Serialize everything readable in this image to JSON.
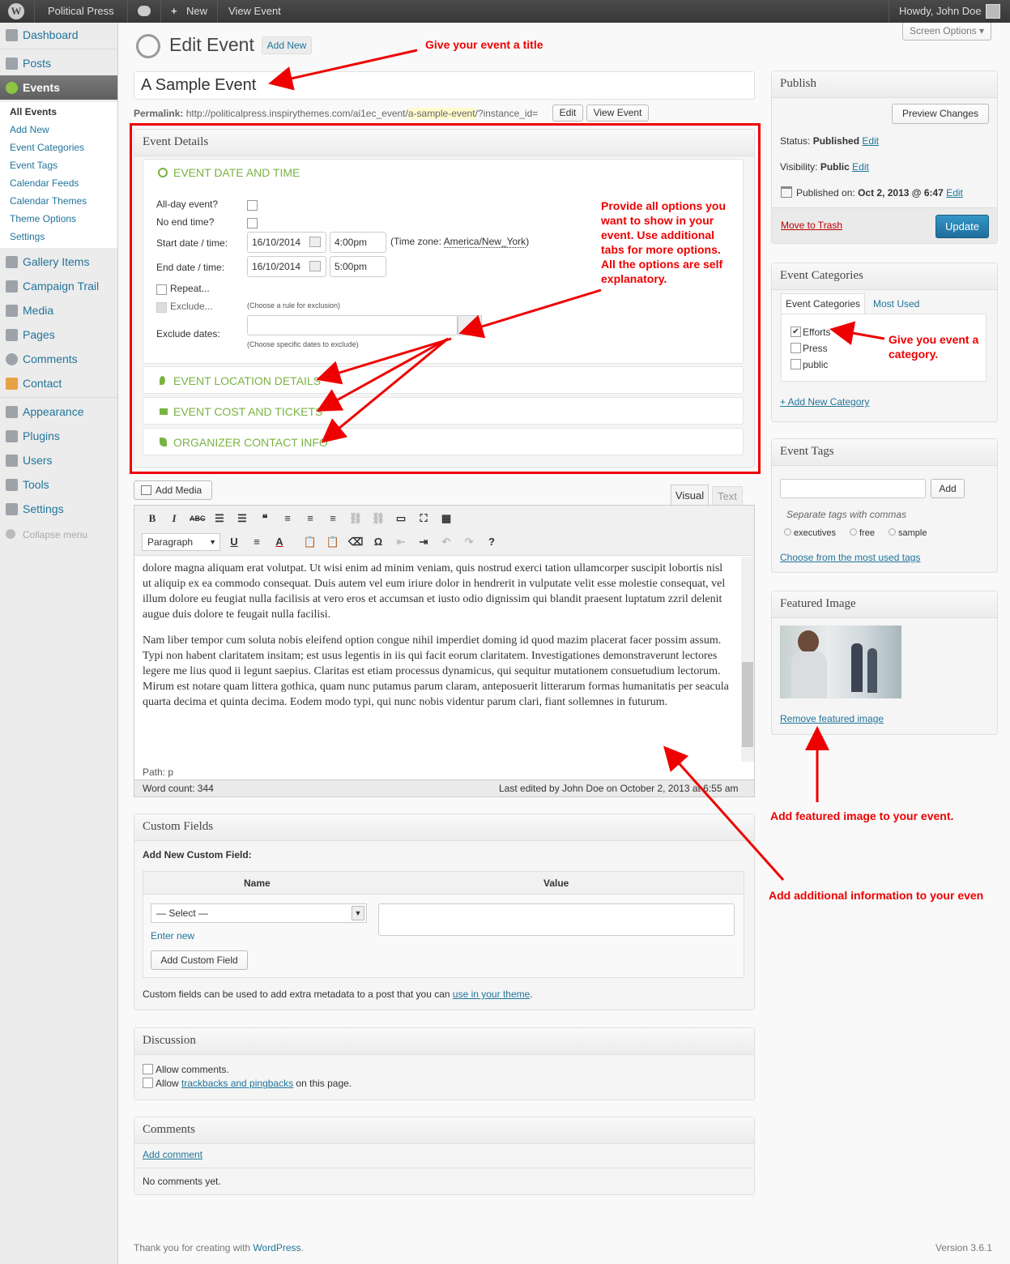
{
  "adminbar": {
    "site": "Political Press",
    "new": "New",
    "view": "View Event",
    "howdy": "Howdy, John Doe"
  },
  "menu": {
    "dashboard": "Dashboard",
    "posts": "Posts",
    "events": "Events",
    "events_sub": [
      "All Events",
      "Add New",
      "Event Categories",
      "Event Tags",
      "Calendar Feeds",
      "Calendar Themes",
      "Theme Options",
      "Settings"
    ],
    "gallery": "Gallery Items",
    "campaign": "Campaign Trail",
    "media": "Media",
    "pages": "Pages",
    "comments": "Comments",
    "contact": "Contact",
    "appearance": "Appearance",
    "plugins": "Plugins",
    "users": "Users",
    "tools": "Tools",
    "settings": "Settings",
    "collapse": "Collapse menu"
  },
  "screen_options": "Screen Options",
  "page": {
    "title": "Edit Event",
    "add_new": "Add New",
    "post_title": "A Sample Event",
    "permalink_label": "Permalink:",
    "permalink_pre": "http://politicalpress.inspirythemes.com/ai1ec_event/",
    "permalink_slug": "a-sample-event",
    "permalink_post": "/?instance_id=",
    "edit_btn": "Edit",
    "view_btn": "View Event"
  },
  "event_details": {
    "title": "Event Details",
    "section_date": "EVENT DATE AND TIME",
    "allday": "All-day event?",
    "noend": "No end time?",
    "start_label": "Start date / time:",
    "start_date": "16/10/2014",
    "start_time": "4:00pm",
    "tz_pre": "(Time zone:",
    "tz": "America/New_York",
    "tz_post": ")",
    "end_label": "End date / time:",
    "end_date": "16/10/2014",
    "end_time": "5:00pm",
    "repeat": "Repeat...",
    "exclude": "Exclude...",
    "exclude_hint": "(Choose a rule for exclusion)",
    "exclude_dates": "Exclude dates:",
    "exclude_dates_hint": "(Choose specific dates to exclude)",
    "location": "EVENT LOCATION DETAILS",
    "cost": "EVENT COST AND TICKETS",
    "organizer": "ORGANIZER CONTACT INFO"
  },
  "editor": {
    "add_media": "Add Media",
    "visual": "Visual",
    "text": "Text",
    "format": "Paragraph",
    "p1": "dolore magna aliquam erat volutpat. Ut wisi enim ad minim veniam, quis nostrud exerci tation ullamcorper suscipit lobortis nisl ut aliquip ex ea commodo consequat. Duis autem vel eum iriure dolor in hendrerit in vulputate velit esse molestie consequat, vel illum dolore eu feugiat nulla facilisis at vero eros et accumsan et iusto odio dignissim qui blandit praesent luptatum zzril delenit augue duis dolore te feugait nulla facilisi.",
    "p2": "Nam liber tempor cum soluta nobis eleifend option congue nihil imperdiet doming id quod mazim placerat facer possim assum. Typi non habent claritatem insitam; est usus legentis in iis qui facit eorum claritatem. Investigationes demonstraverunt lectores legere me lius quod ii legunt saepius. Claritas est etiam processus dynamicus, qui sequitur mutationem consuetudium lectorum. Mirum est notare quam littera gothica, quam nunc putamus parum claram, anteposuerit litterarum formas humanitatis per seacula quarta decima et quinta decima. Eodem modo typi, qui nunc nobis videntur parum clari, fiant sollemnes in futurum.",
    "path": "Path: p",
    "wordcount": "Word count: 344",
    "last_edited": "Last edited by John Doe on October 2, 2013 at 6:55 am"
  },
  "custom_fields": {
    "title": "Custom Fields",
    "add_new": "Add New Custom Field:",
    "name_col": "Name",
    "value_col": "Value",
    "select": "— Select —",
    "enter_new": "Enter new",
    "add_btn": "Add Custom Field",
    "note_pre": "Custom fields can be used to add extra metadata to a post that you can ",
    "note_link": "use in your theme",
    "note_post": "."
  },
  "discussion": {
    "title": "Discussion",
    "allow_comments": "Allow comments.",
    "allow_pre": "Allow ",
    "allow_link": "trackbacks and pingbacks",
    "allow_post": " on this page."
  },
  "comments": {
    "title": "Comments",
    "add": "Add comment",
    "none": "No comments yet."
  },
  "publish": {
    "title": "Publish",
    "preview": "Preview Changes",
    "status_label": "Status:",
    "status": "Published",
    "visibility_label": "Visibility:",
    "visibility": "Public",
    "published_label": "Published on:",
    "published": "Oct 2, 2013 @ 6:47",
    "edit": "Edit",
    "trash": "Move to Trash",
    "update": "Update"
  },
  "categories": {
    "title": "Event Categories",
    "tab_all": "Event Categories",
    "tab_used": "Most Used",
    "items": [
      {
        "label": "Efforts",
        "checked": true
      },
      {
        "label": "Press",
        "checked": false
      },
      {
        "label": "public",
        "checked": false
      }
    ],
    "add": "+ Add New Category"
  },
  "tags": {
    "title": "Event Tags",
    "add": "Add",
    "hint": "Separate tags with commas",
    "items": [
      "executives",
      "free",
      "sample"
    ],
    "choose": "Choose from the most used tags"
  },
  "featured": {
    "title": "Featured Image",
    "remove": "Remove featured image"
  },
  "annotations": {
    "title": "Give your event a title",
    "options": "Provide all options you want to show in your event. Use additional tabs for more options. All the options are self explanatory.",
    "category": "Give you event a category.",
    "featured": "Add featured image to your event.",
    "additional": "Add additional information to your even"
  },
  "footer": {
    "thanks_pre": "Thank you for creating with ",
    "thanks_link": "WordPress",
    "thanks_post": ".",
    "version": "Version 3.6.1"
  },
  "colors": {
    "annotation": "#e00000",
    "accent": "#7ab342",
    "link": "#21759b",
    "update": "#2a8bbb"
  }
}
